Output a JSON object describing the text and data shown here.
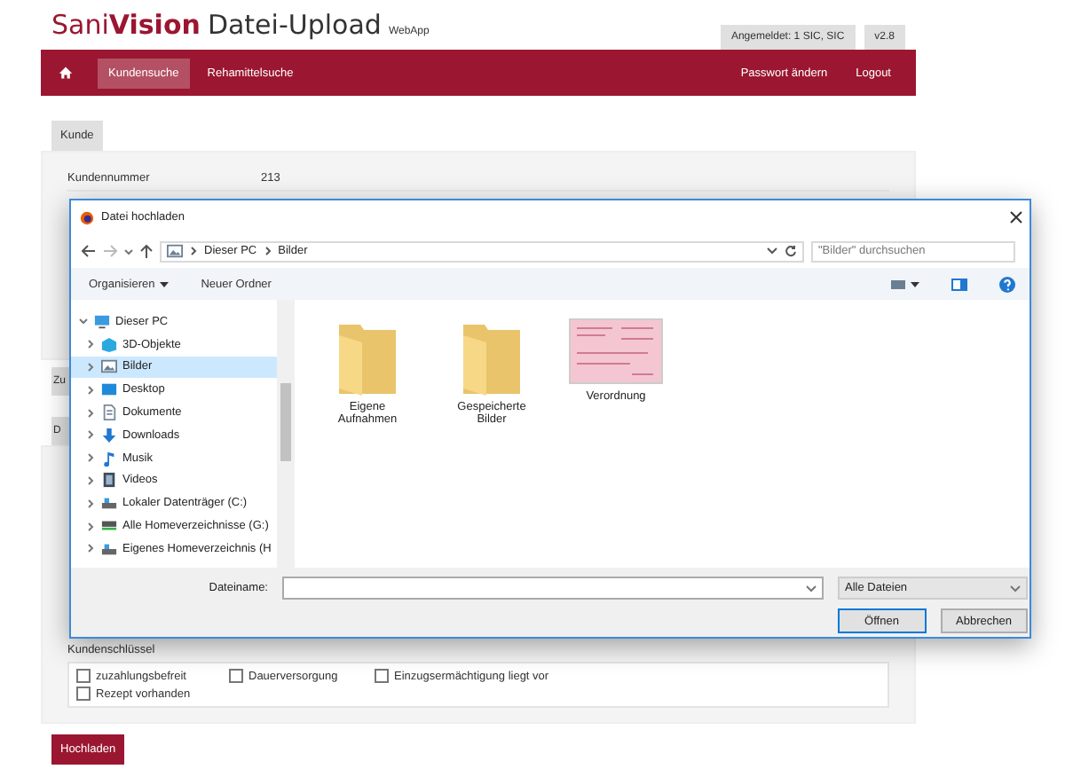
{
  "header": {
    "brand_light": "Sani",
    "brand_bold": "Vision",
    "title": "Datei-Upload",
    "subtitle": "WebApp",
    "user": "Angemeldet: 1 SIC, SIC",
    "version": "v2.8"
  },
  "nav": {
    "left": [
      {
        "label": "Kundensuche",
        "selected": true
      },
      {
        "label": "Rehamittelsuche",
        "selected": false
      }
    ],
    "right": [
      {
        "label": "Passwort ändern"
      },
      {
        "label": "Logout"
      }
    ]
  },
  "customer": {
    "tab": "Kunde",
    "fields": [
      {
        "label": "Kundennummer",
        "value": "213"
      }
    ]
  },
  "partial_tabs": [
    "Zu",
    "D"
  ],
  "keys": {
    "label": "Kundenschlüssel",
    "options": [
      {
        "label": "zuzahlungsbefreit",
        "checked": false
      },
      {
        "label": "Dauerversorgung",
        "checked": false
      },
      {
        "label": "Einzugsermächtigung liegt vor",
        "checked": false
      },
      {
        "label": "Rezept vorhanden",
        "checked": false
      }
    ]
  },
  "upload_button": "Hochladen",
  "dialog": {
    "title": "Datei hochladen",
    "path": [
      "Dieser PC",
      "Bilder"
    ],
    "search": {
      "placeholder": "\"Bilder\" durchsuchen"
    },
    "toolbar": [
      "Organisieren",
      "Neuer Ordner"
    ],
    "tree": [
      {
        "label": "Dieser PC",
        "kind": "pc",
        "expanded": true,
        "selected": false,
        "children": [
          {
            "label": "3D-Objekte",
            "kind": "cube",
            "selected": false
          },
          {
            "label": "Bilder",
            "kind": "pictures",
            "selected": true
          },
          {
            "label": "Desktop",
            "kind": "desktop",
            "selected": false
          },
          {
            "label": "Dokumente",
            "kind": "document",
            "selected": false
          },
          {
            "label": "Downloads",
            "kind": "download",
            "selected": false
          },
          {
            "label": "Musik",
            "kind": "music",
            "selected": false
          },
          {
            "label": "Videos",
            "kind": "video",
            "selected": false
          },
          {
            "label": "Lokaler Datenträger (C:)",
            "kind": "drive",
            "selected": false
          },
          {
            "label": "Alle Homeverzeichnisse (G:)",
            "kind": "netdrive",
            "selected": false
          },
          {
            "label": "Eigenes Homeverzeichnis (H",
            "kind": "drive",
            "selected": false
          }
        ]
      }
    ],
    "files": [
      {
        "name": "Eigene Aufnahmen",
        "kind": "folder"
      },
      {
        "name": "Gespeicherte Bilder",
        "kind": "folder"
      },
      {
        "name": "Verordnung",
        "kind": "image"
      }
    ],
    "filename_label": "Dateiname:",
    "filter": "Alle Dateien",
    "buttons": [
      "Öffnen",
      "Abbrechen"
    ]
  }
}
